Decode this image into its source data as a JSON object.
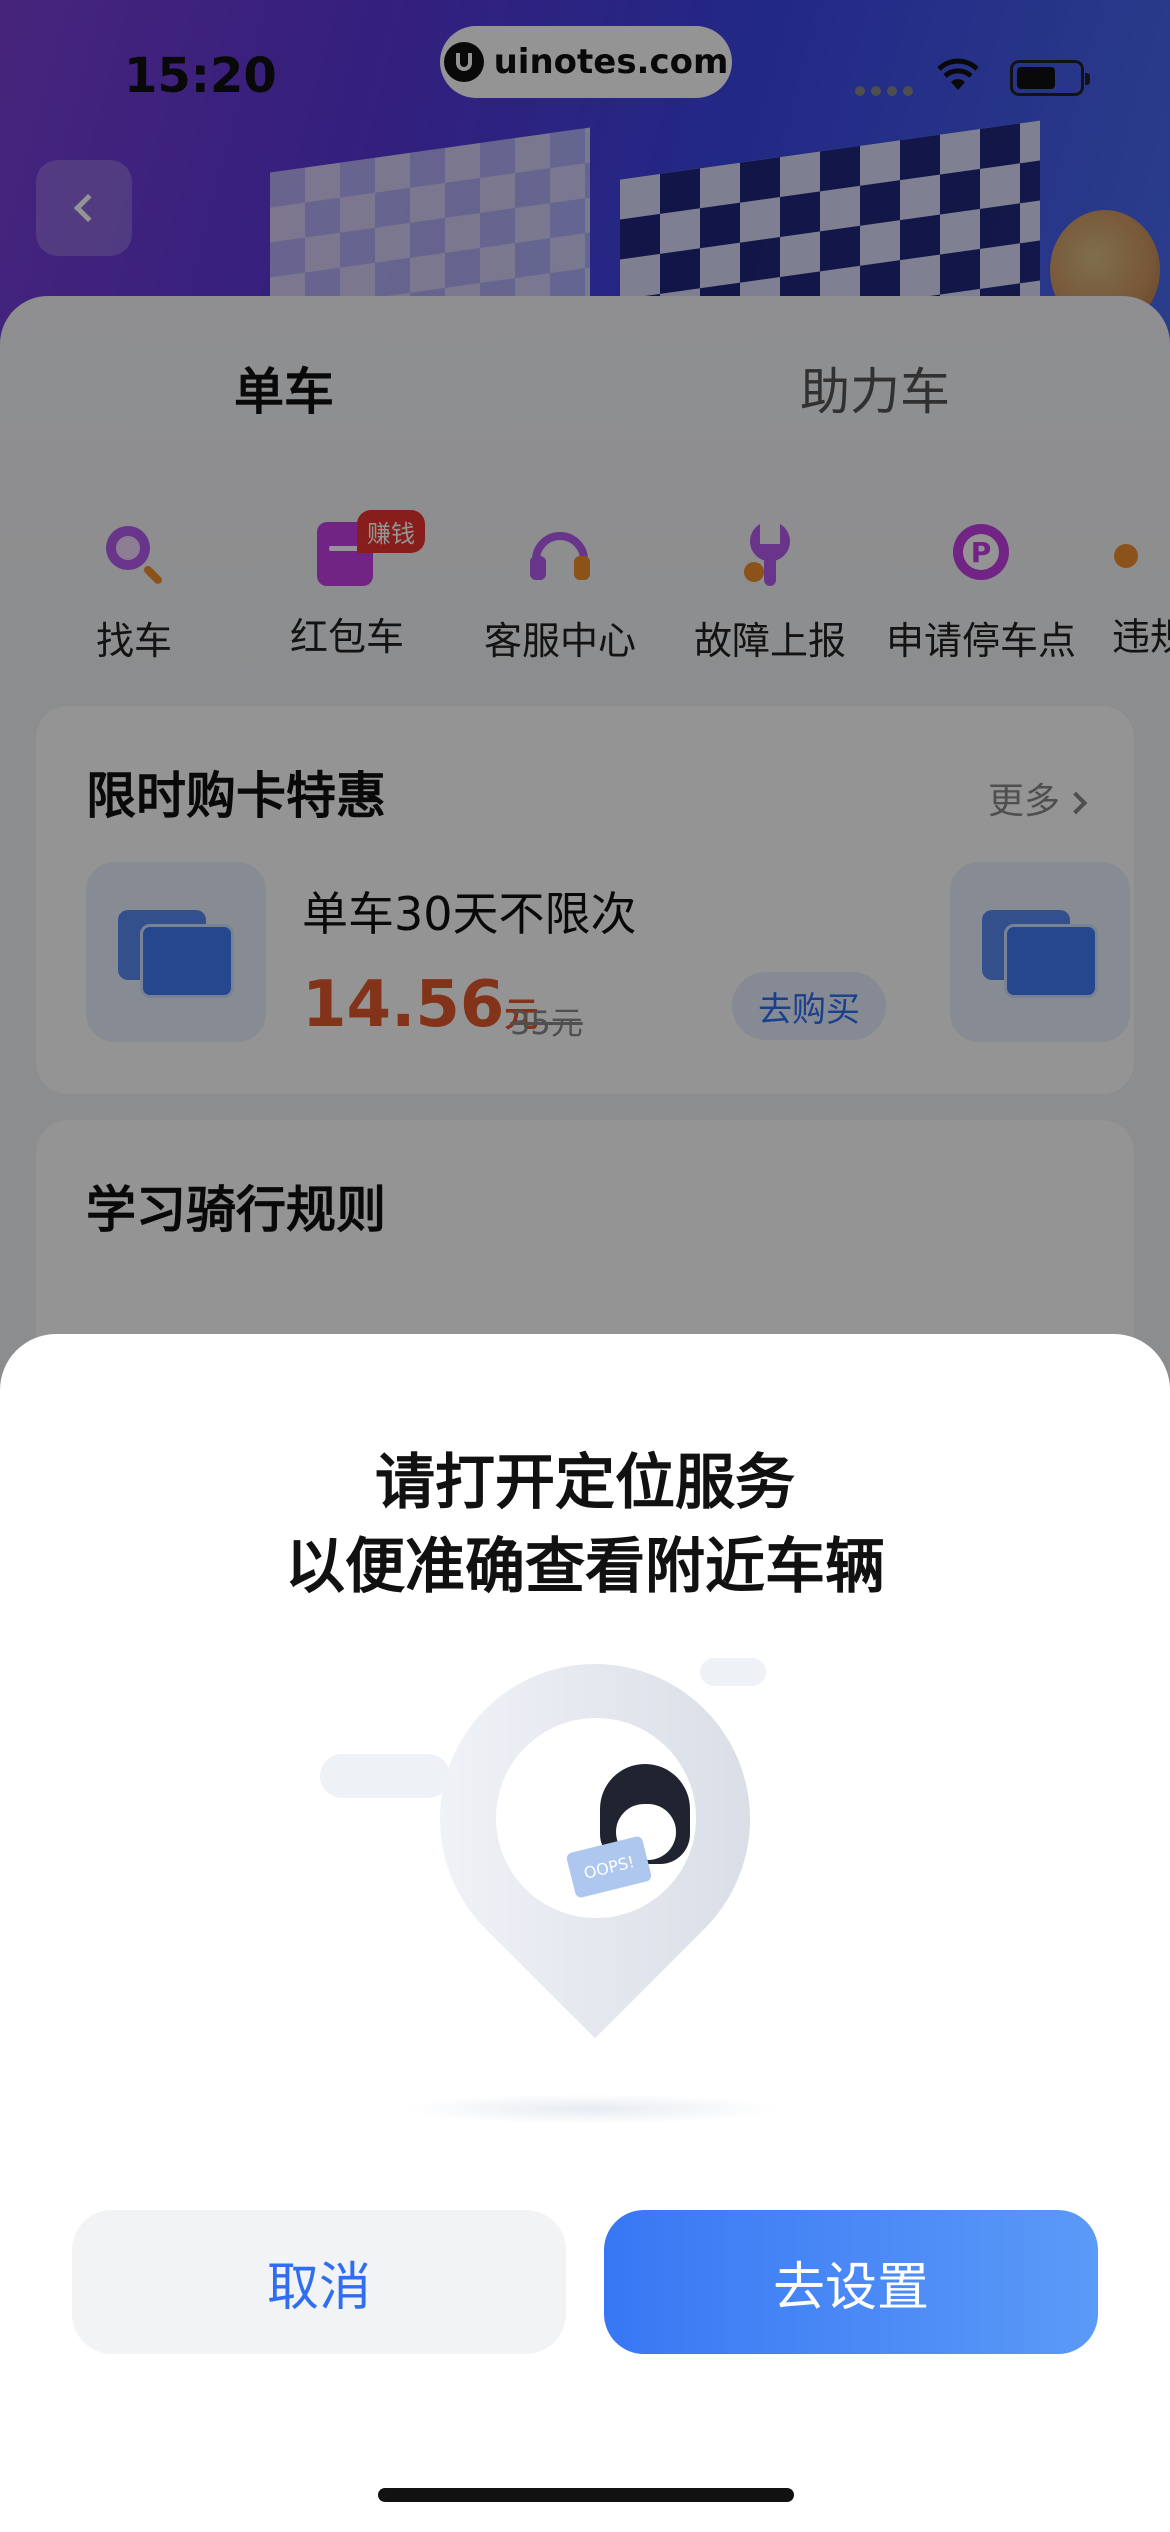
{
  "status_bar": {
    "time": "15:20",
    "url_label": "uinotes.com"
  },
  "tabs": {
    "active": "单车",
    "inactive": "助力车"
  },
  "icons": [
    {
      "label": "找车",
      "icon": "search-bike-icon"
    },
    {
      "label": "红包车",
      "icon": "red-packet-icon",
      "badge": "赚钱"
    },
    {
      "label": "客服中心",
      "icon": "headset-icon"
    },
    {
      "label": "故障上报",
      "icon": "wrench-icon"
    },
    {
      "label": "申请停车点",
      "icon": "parking-icon"
    },
    {
      "label": "违规",
      "icon": "violation-icon"
    }
  ],
  "promo": {
    "title": "限时购卡特惠",
    "more": "更多",
    "product_name": "单车30天不限次",
    "price": "14.56",
    "price_unit": "元",
    "original_price": "35元",
    "buy_label": "去购买"
  },
  "rules": {
    "title": "学习骑行规则"
  },
  "dialog": {
    "title_line1": "请打开定位服务",
    "title_line2": "以便准确查看附近车辆",
    "sign_text": "OOPS!",
    "cancel_label": "取消",
    "confirm_label": "去设置"
  },
  "colors": {
    "accent": "#2f6ef0",
    "price": "#e2582b",
    "badge": "#e8352f"
  }
}
